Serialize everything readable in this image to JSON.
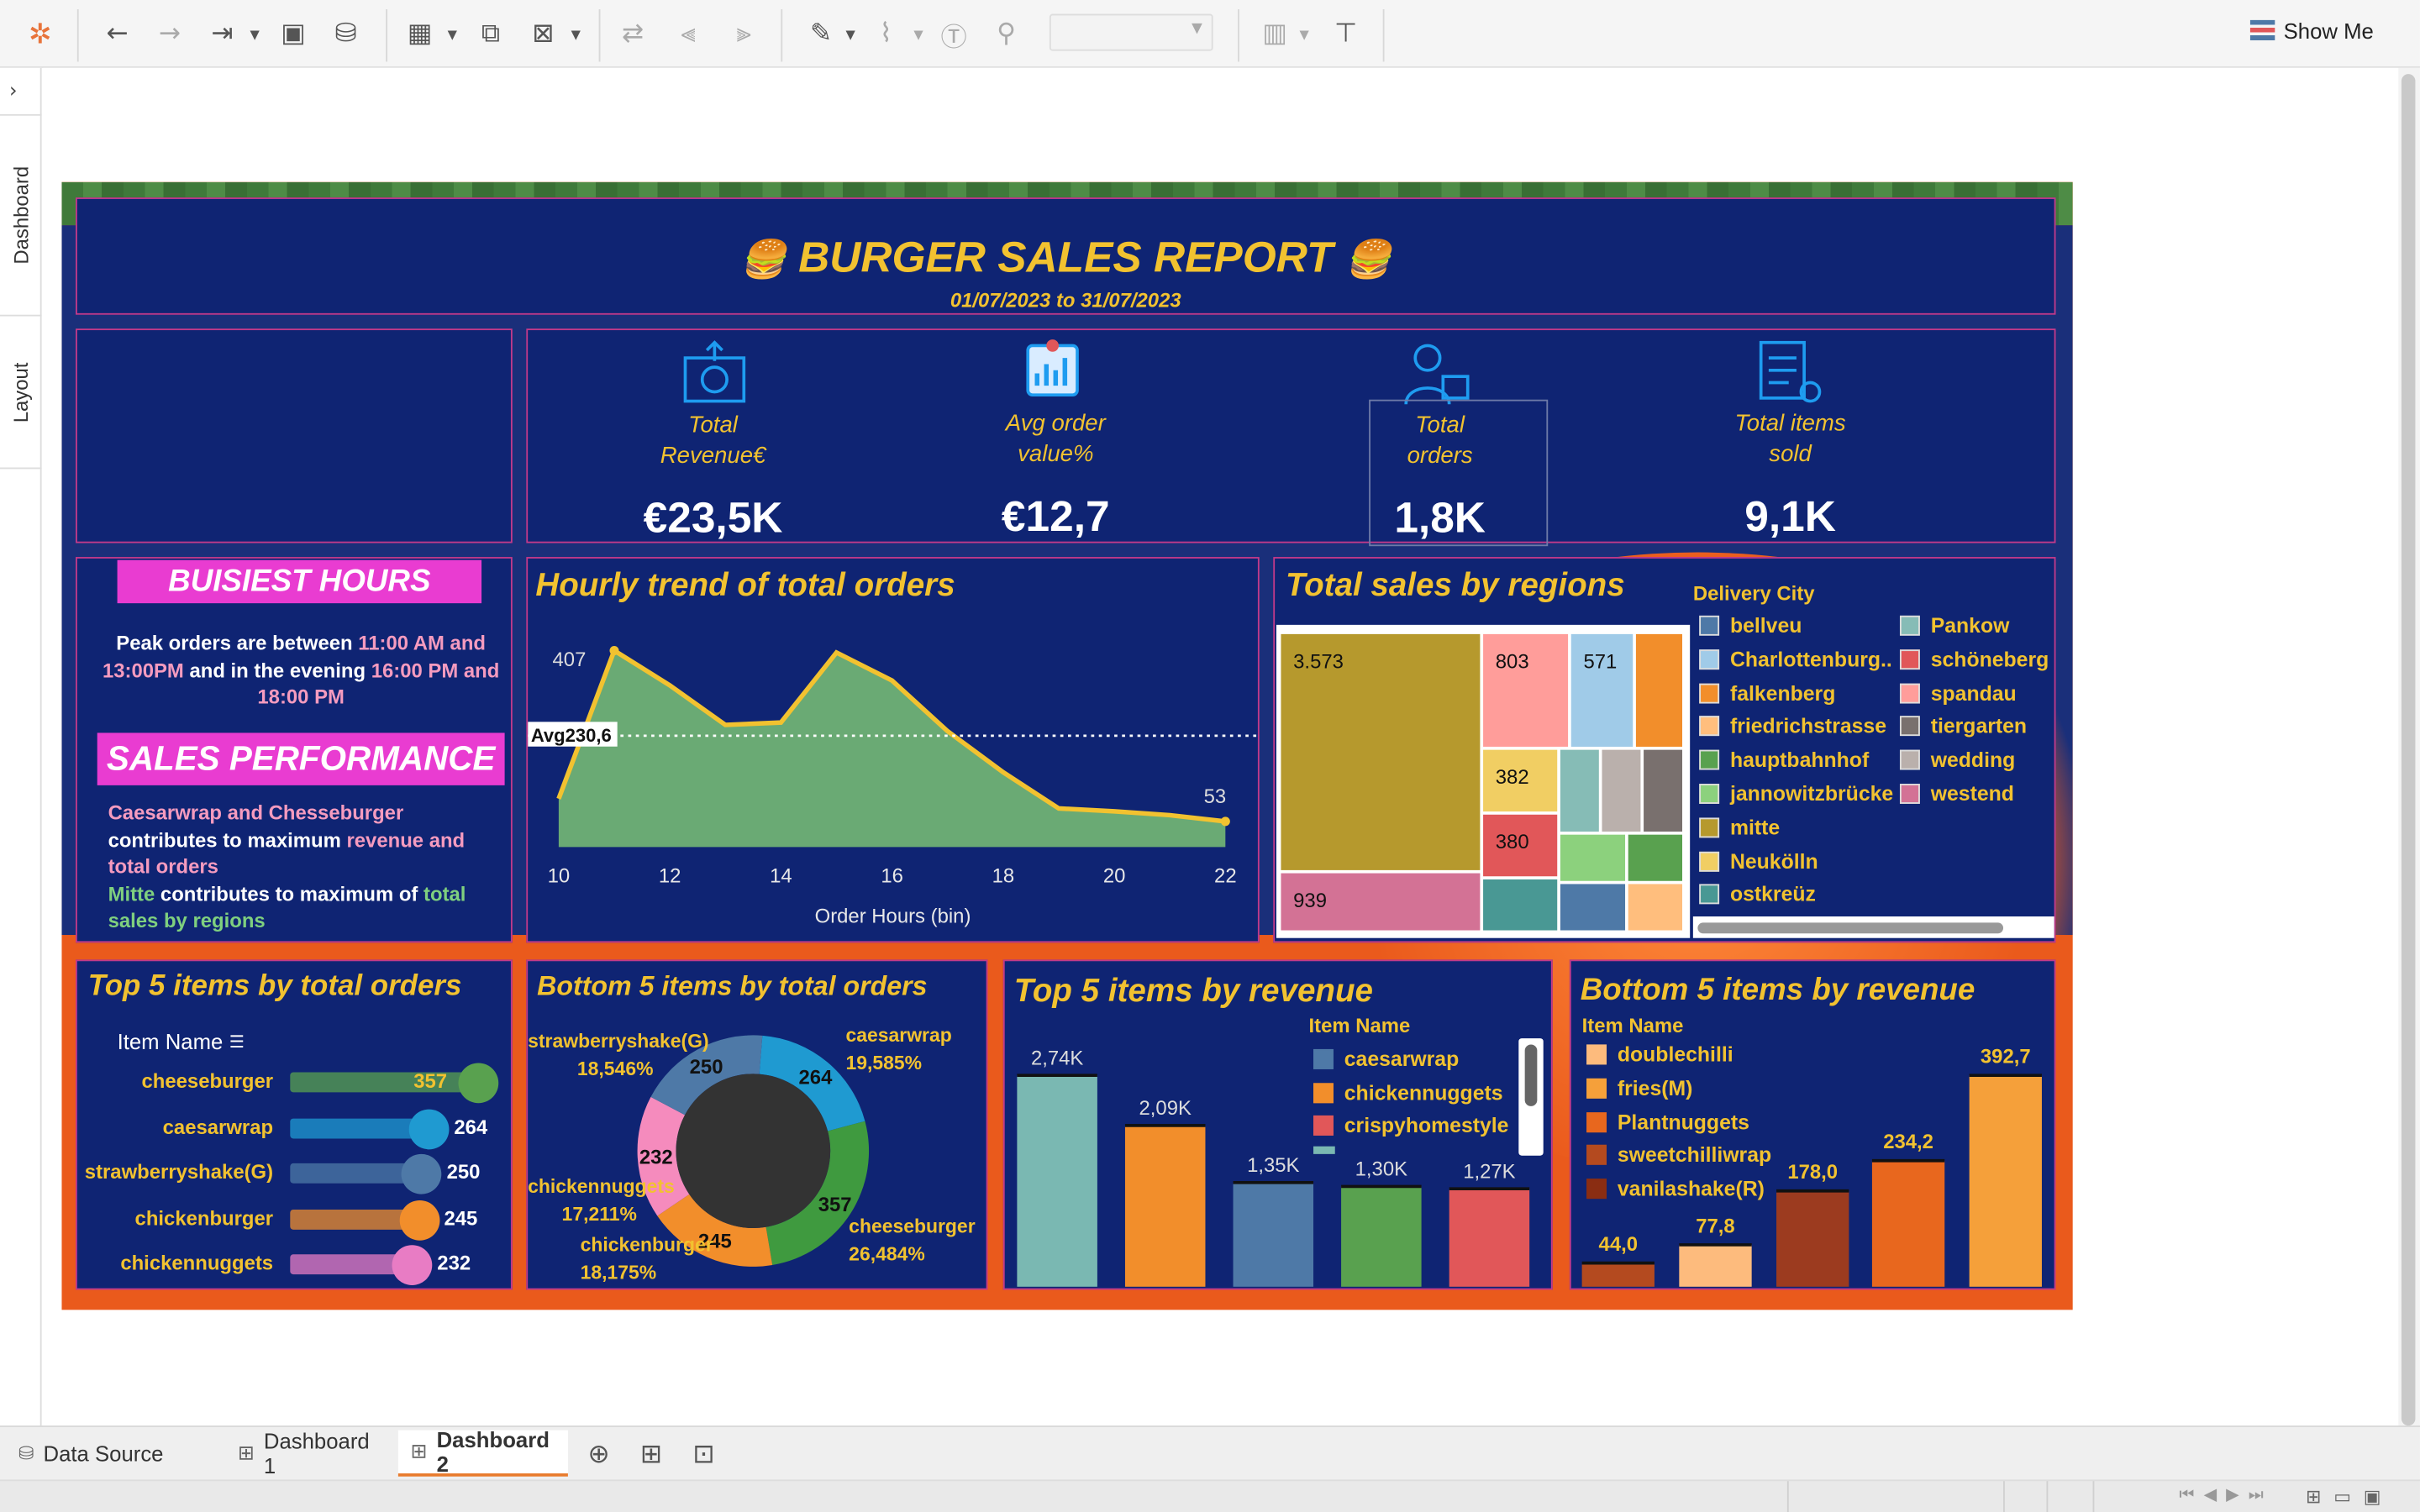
{
  "toolbar": {
    "show_me": "Show Me"
  },
  "rail": {
    "dashboard_tab": "Dashboard",
    "layout_tab": "Layout"
  },
  "header": {
    "title": "BURGER SALES REPORT",
    "date_range": "01/07/2023 to 31/07/2023"
  },
  "kpis": [
    {
      "label_l1": "Total",
      "label_l2": "Revenue€",
      "value": "€23,5K"
    },
    {
      "label_l1": "Avg order",
      "label_l2": "value%",
      "value": "€12,7"
    },
    {
      "label_l1": "Total",
      "label_l2": "orders",
      "value": "1,8K"
    },
    {
      "label_l1": "Total items",
      "label_l2": "sold",
      "value": "9,1K"
    }
  ],
  "insights": {
    "busiest_title": "BUISIEST HOURS",
    "busiest_p1": "Peak orders are between ",
    "busiest_h1": "11:00 AM and",
    "busiest_h2": "13:00PM",
    "busiest_p2": " and in the evening ",
    "busiest_h3": "16:00 PM and",
    "busiest_h4": "18:00 PM",
    "sales_title": "SALES PERFORMANCE",
    "sales_a": "Caesarwrap  and Chesseburger",
    "sales_b": "contributes to maximum ",
    "sales_c": "revenue and",
    "sales_d": "total orders",
    "sales_e": "Mitte",
    "sales_f": " contributes to maximum of ",
    "sales_g": "total",
    "sales_h": "sales by regions"
  },
  "chart_data": [
    {
      "type": "area",
      "title": "Hourly trend of total orders",
      "xlabel": "Order Hours (bin)",
      "x": [
        10,
        11,
        12,
        13,
        14,
        15,
        16,
        17,
        18,
        19,
        20,
        21,
        22
      ],
      "values": [
        100,
        407,
        335,
        253,
        258,
        403,
        345,
        240,
        155,
        80,
        74,
        66,
        53
      ],
      "labeled_points": {
        "max_label": "407",
        "last_label": "53"
      },
      "average": 230.6,
      "average_label": "Avg230,6",
      "xticks": [
        "10",
        "12",
        "14",
        "16",
        "18",
        "20",
        "22"
      ],
      "xlim": [
        10,
        22
      ],
      "ylim": [
        0,
        470
      ],
      "colors": {
        "area": "#6aaa74",
        "line": "#f2c230"
      }
    },
    {
      "type": "treemap",
      "title": "Total sales by regions",
      "legend_title": "Delivery City",
      "legend": [
        {
          "name": "bellveu",
          "color": "#4e79a7"
        },
        {
          "name": "Charlottenburg..",
          "color": "#a0cbe8"
        },
        {
          "name": "falkenberg",
          "color": "#f28e2b"
        },
        {
          "name": "friedrichstrasse",
          "color": "#ffbe7d"
        },
        {
          "name": "hauptbahnhof",
          "color": "#59a14f"
        },
        {
          "name": "jannowitzbrücke",
          "color": "#8cd17d"
        },
        {
          "name": "mitte",
          "color": "#b6992d"
        },
        {
          "name": "Neukölln",
          "color": "#f1ce63"
        },
        {
          "name": "ostkreüz",
          "color": "#499894"
        },
        {
          "name": "Pankow",
          "color": "#86bcb6"
        },
        {
          "name": "schöneberg",
          "color": "#e15759"
        },
        {
          "name": "spandau",
          "color": "#ff9d9a"
        },
        {
          "name": "tiergarten",
          "color": "#79706e"
        },
        {
          "name": "wedding",
          "color": "#bab0ac"
        },
        {
          "name": "westend",
          "color": "#d37295"
        }
      ],
      "labels": [
        "3.573",
        "803",
        "571",
        "382",
        "380",
        "939"
      ]
    },
    {
      "type": "bar",
      "title": "Top 5 items by total orders",
      "header": "Item Name",
      "categories": [
        "cheeseburger",
        "caesarwrap",
        "strawberryshake(G)",
        "chickenburger",
        "chickennuggets"
      ],
      "values": [
        357,
        264,
        250,
        245,
        232
      ],
      "colors": [
        "#59a14f",
        "#1f9ad1",
        "#4e79a7",
        "#f28e2b",
        "#e87cc4"
      ]
    },
    {
      "type": "pie",
      "title": "Bottom 5 items by total orders",
      "categories": [
        "caesarwrap",
        "cheeseburger",
        "chickenburger",
        "chickennuggets",
        "strawberryshake(G)"
      ],
      "values": [
        264,
        357,
        245,
        232,
        250
      ],
      "percent_labels": [
        "19,585%",
        "26,484%",
        "18,175%",
        "17,211%",
        "18,546%"
      ],
      "colors": [
        "#1f9ad1",
        "#3f9a3f",
        "#f28e2b",
        "#f58bbd",
        "#4e79a7"
      ]
    },
    {
      "type": "bar",
      "title": "Top 5 items by revenue",
      "legend_title": "Item Name",
      "legend": [
        "caesarwrap",
        "chickennuggets",
        "crispyhomestyle"
      ],
      "values": [
        2740,
        2090,
        1350,
        1300,
        1270
      ],
      "value_labels": [
        "2,74K",
        "2,09K",
        "1,35K",
        "1,30K",
        "1,27K"
      ],
      "colors": [
        "#7ab8b2",
        "#f28e2b",
        "#4e79a7",
        "#59a14f",
        "#e15759"
      ],
      "ylim": [
        0,
        3000
      ]
    },
    {
      "type": "bar",
      "title": "Bottom 5 items by revenue",
      "legend_title": "Item Name",
      "legend": [
        {
          "name": "doublechilli",
          "color": "#fdbb7d"
        },
        {
          "name": "fries(M)",
          "color": "#f5a03a"
        },
        {
          "name": "Plantnuggets",
          "color": "#e8671e"
        },
        {
          "name": "sweetchilliwrap",
          "color": "#b44a1f"
        },
        {
          "name": "vanilashake(R)",
          "color": "#8a2d12"
        }
      ],
      "values": [
        44.0,
        77.8,
        178.0,
        234.2,
        392.7
      ],
      "value_labels": [
        "44,0",
        "77,8",
        "178,0",
        "234,2",
        "392,7"
      ],
      "colors": [
        "#b44a1f",
        "#fdbb7d",
        "#9c3b1f",
        "#e8671e",
        "#f5a03a"
      ],
      "ylim": [
        0,
        430
      ]
    }
  ],
  "sheet_tabs": {
    "data_source": "Data Source",
    "dash1": "Dashboard 1",
    "dash2": "Dashboard 2"
  }
}
